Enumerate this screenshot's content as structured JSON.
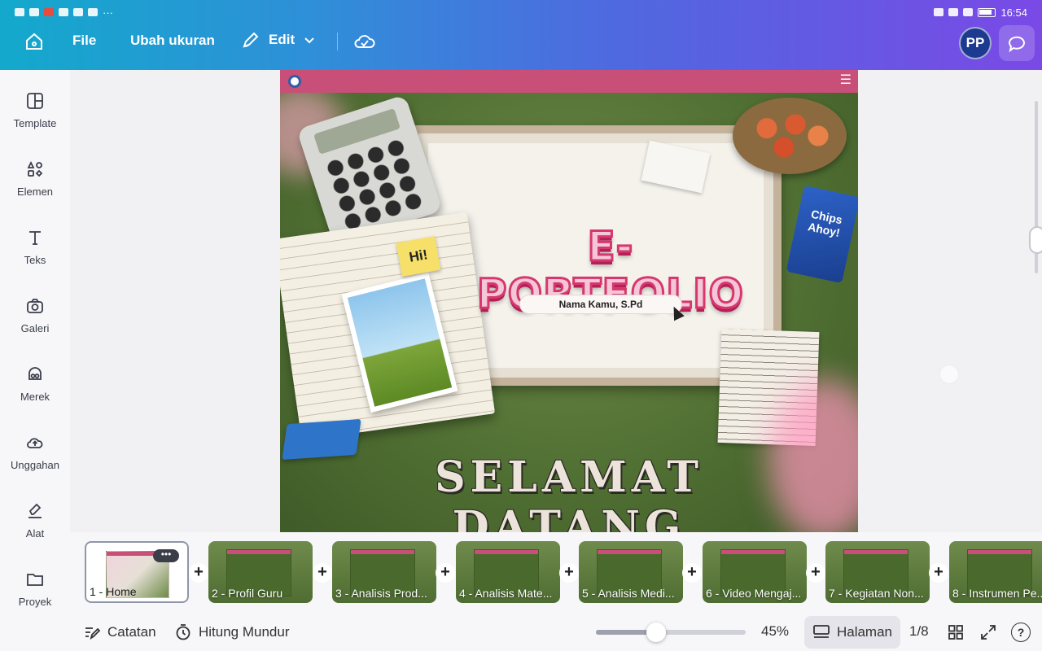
{
  "status": {
    "time": "16:54"
  },
  "header": {
    "file_label": "File",
    "resize_label": "Ubah ukuran",
    "edit_label": "Edit",
    "avatar_initials": "PP"
  },
  "sidebar": {
    "items": [
      {
        "label": "Template",
        "icon": "template-icon"
      },
      {
        "label": "Elemen",
        "icon": "elements-icon"
      },
      {
        "label": "Teks",
        "icon": "text-icon"
      },
      {
        "label": "Galeri",
        "icon": "camera-icon"
      },
      {
        "label": "Merek",
        "icon": "brand-icon"
      },
      {
        "label": "Unggahan",
        "icon": "upload-cloud-icon"
      },
      {
        "label": "Alat",
        "icon": "draw-tool-icon"
      },
      {
        "label": "Proyek",
        "icon": "folder-icon"
      }
    ]
  },
  "slide": {
    "title": "E-PORTFOLIO",
    "name_pill": "Nama Kamu, S.Pd",
    "welcome": "SELAMAT DATANG",
    "postit": "Hi!",
    "chips_text": "Chips Ahoy!"
  },
  "pages": {
    "items": [
      {
        "label": "1 - Home"
      },
      {
        "label": "2 - Profil Guru"
      },
      {
        "label": "3 - Analisis Prod..."
      },
      {
        "label": "4 - Analisis Mate..."
      },
      {
        "label": "5 - Analisis Medi..."
      },
      {
        "label": "6 - Video Mengaj..."
      },
      {
        "label": "7 - Kegiatan Non..."
      },
      {
        "label": "8 - Instrumen Pe..."
      }
    ],
    "active_index": 0,
    "more_label": "•••"
  },
  "bottom": {
    "notes_label": "Catatan",
    "timer_label": "Hitung Mundur",
    "zoom_value": "45%",
    "zoom_fraction": 0.4,
    "pages_label": "Halaman",
    "page_counter": "1/8",
    "help_label": "?"
  },
  "colors": {
    "accent_gradient_start": "#13a9cc",
    "accent_gradient_end": "#7a49e6",
    "slide_header": "#c84f78"
  }
}
